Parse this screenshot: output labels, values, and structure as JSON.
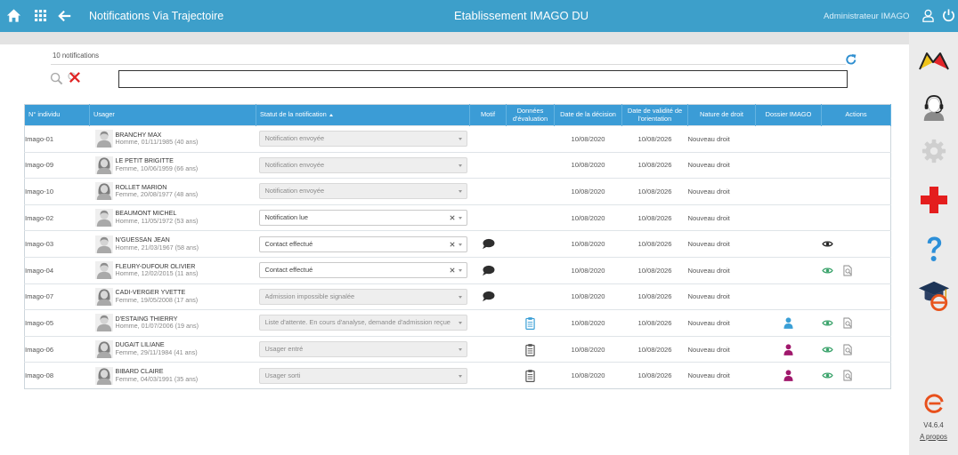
{
  "topbar": {
    "title": "Notifications Via Trajectoire",
    "establishment": "Etablissement IMAGO DU",
    "user_label": "Administrateur IMAGO",
    "icons": {
      "home": "home-icon",
      "apps": "grid-icon",
      "back": "back-arrow-icon",
      "user": "user-icon",
      "logout": "power-icon"
    }
  },
  "search": {
    "count_label": "10 notifications",
    "value": "",
    "icons": {
      "search": "search-icon",
      "clear": "clear-filter-icon",
      "refresh": "refresh-icon"
    }
  },
  "table": {
    "headers": {
      "id": "N° individu",
      "user": "Usager",
      "status": "Statut de la notification",
      "motif": "Motif",
      "evaluation": "Données d'évaluation",
      "decision_date": "Date de la décision",
      "validity_date": "Date de validité de l'orientation",
      "nature": "Nature de droit",
      "dossier": "Dossier IMAGO",
      "actions": "Actions"
    },
    "sort": {
      "column": "status",
      "direction": "asc",
      "icon": "sort-asc-icon"
    },
    "rows": [
      {
        "id": "Imago-01",
        "name": "BRANCHY MAX",
        "details": "Homme, 01/11/1985 (40 ans)",
        "avatar": "male-avatar-icon",
        "status": "Notification envoyée",
        "status_disabled": true,
        "motif": null,
        "evaluation": null,
        "decision_date": "10/08/2020",
        "validity_date": "10/08/2026",
        "nature": "Nouveau droit",
        "dossier": null,
        "actions": []
      },
      {
        "id": "Imago-09",
        "name": "LE PETIT BRIGITTE",
        "details": "Femme, 10/06/1959 (66 ans)",
        "avatar": "female-avatar-icon",
        "status": "Notification envoyée",
        "status_disabled": true,
        "motif": null,
        "evaluation": null,
        "decision_date": "10/08/2020",
        "validity_date": "10/08/2026",
        "nature": "Nouveau droit",
        "dossier": null,
        "actions": []
      },
      {
        "id": "Imago-10",
        "name": "ROLLET MARION",
        "details": "Femme, 20/08/1977 (48 ans)",
        "avatar": "female-avatar-icon",
        "status": "Notification envoyée",
        "status_disabled": true,
        "motif": null,
        "evaluation": null,
        "decision_date": "10/08/2020",
        "validity_date": "10/08/2026",
        "nature": "Nouveau droit",
        "dossier": null,
        "actions": []
      },
      {
        "id": "Imago-02",
        "name": "BEAUMONT MICHEL",
        "details": "Homme, 11/05/1972 (53 ans)",
        "avatar": "male-avatar-icon",
        "status": "Notification lue",
        "status_disabled": false,
        "motif": null,
        "evaluation": null,
        "decision_date": "10/08/2020",
        "validity_date": "10/08/2026",
        "nature": "Nouveau droit",
        "dossier": null,
        "actions": []
      },
      {
        "id": "Imago-03",
        "name": "N'GUESSAN JEAN",
        "details": "Homme, 21/03/1967 (58 ans)",
        "avatar": "male-avatar-icon",
        "status": "Contact effectué",
        "status_disabled": false,
        "motif": {
          "icon": "comment-icon",
          "color": "#2e2e2e"
        },
        "evaluation": null,
        "decision_date": "10/08/2020",
        "validity_date": "10/08/2026",
        "nature": "Nouveau droit",
        "dossier": null,
        "actions": [
          {
            "icon": "view-icon",
            "color": "#222222"
          }
        ]
      },
      {
        "id": "Imago-04",
        "name": "FLEURY-DUFOUR OLIVIER",
        "details": "Homme, 12/02/2015 (11 ans)",
        "avatar": "male-avatar-icon",
        "status": "Contact effectué",
        "status_disabled": false,
        "motif": {
          "icon": "comment-icon",
          "color": "#2e2e2e"
        },
        "evaluation": null,
        "decision_date": "10/08/2020",
        "validity_date": "10/08/2026",
        "nature": "Nouveau droit",
        "dossier": null,
        "actions": [
          {
            "icon": "view-icon",
            "color": "#3aa36b"
          },
          {
            "icon": "document-search-icon",
            "color": "#8a8a8a"
          }
        ]
      },
      {
        "id": "Imago-07",
        "name": "CADI-VERGER YVETTE",
        "details": "Femme, 19/05/2008 (17 ans)",
        "avatar": "female-avatar-icon",
        "status": "Admission impossible signalée",
        "status_disabled": true,
        "motif": {
          "icon": "comment-icon",
          "color": "#2e2e2e"
        },
        "evaluation": null,
        "decision_date": "10/08/2020",
        "validity_date": "10/08/2026",
        "nature": "Nouveau droit",
        "dossier": null,
        "actions": []
      },
      {
        "id": "Imago-05",
        "name": "D'ESTAING THIERRY",
        "details": "Homme, 01/07/2006 (19 ans)",
        "avatar": "male-avatar-icon",
        "status": "Liste d'attente. En cours d'analyse, demande d'admission reçue",
        "status_disabled": true,
        "motif": null,
        "evaluation": {
          "icon": "clipboard-icon",
          "color": "#3a9fd6"
        },
        "decision_date": "10/08/2020",
        "validity_date": "10/08/2026",
        "nature": "Nouveau droit",
        "dossier": {
          "icon": "user-file-icon",
          "color": "#3a9fd6"
        },
        "actions": [
          {
            "icon": "view-icon",
            "color": "#3aa36b"
          },
          {
            "icon": "document-search-icon",
            "color": "#8a8a8a"
          }
        ]
      },
      {
        "id": "Imago-06",
        "name": "DUGAIT LILIANE",
        "details": "Femme, 29/11/1984 (41 ans)",
        "avatar": "female-avatar-icon",
        "status": "Usager entré",
        "status_disabled": true,
        "motif": null,
        "evaluation": {
          "icon": "clipboard-icon",
          "color": "#555555"
        },
        "decision_date": "10/08/2020",
        "validity_date": "10/08/2026",
        "nature": "Nouveau droit",
        "dossier": {
          "icon": "user-file-icon",
          "color": "#a0186c"
        },
        "actions": [
          {
            "icon": "view-icon",
            "color": "#3aa36b"
          },
          {
            "icon": "document-search-icon",
            "color": "#8a8a8a"
          }
        ]
      },
      {
        "id": "Imago-08",
        "name": "BIBARD CLAIRE",
        "details": "Femme, 04/03/1991 (35 ans)",
        "avatar": "female-avatar-icon",
        "status": "Usager sorti",
        "status_disabled": true,
        "motif": null,
        "evaluation": {
          "icon": "clipboard-icon",
          "color": "#555555"
        },
        "decision_date": "10/08/2020",
        "validity_date": "10/08/2026",
        "nature": "Nouveau droit",
        "dossier": {
          "icon": "user-file-icon",
          "color": "#a0186c"
        },
        "actions": [
          {
            "icon": "view-icon",
            "color": "#3aa36b"
          },
          {
            "icon": "document-search-icon",
            "color": "#8a8a8a"
          }
        ]
      }
    ]
  },
  "sidebar": {
    "icons": [
      "flags-icon",
      "support-headset-icon",
      "settings-gear-icon",
      "medical-cross-icon",
      "help-icon",
      "training-icon"
    ],
    "logo": "app-logo-icon",
    "version": "V4.6.4",
    "about_link": "A propos"
  },
  "colors": {
    "topbar": "#3d9fca",
    "table_header": "#3b9cd6",
    "view_green": "#3aa36b",
    "dossier_magenta": "#a0186c",
    "accent_blue": "#3a9fd6",
    "cross_red": "#e41e1e",
    "logo_orange": "#e8501c"
  }
}
